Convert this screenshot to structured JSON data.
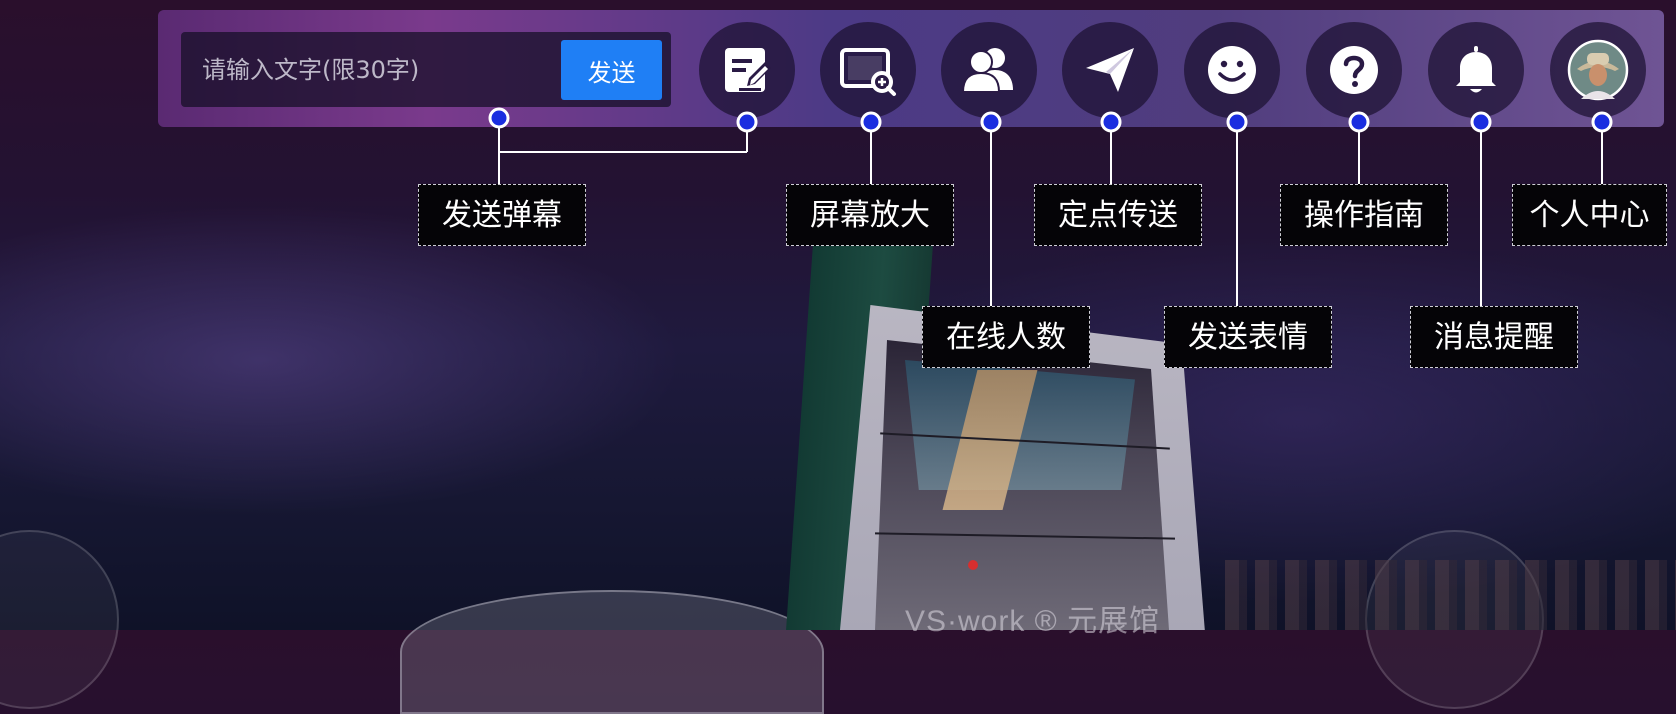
{
  "toolbar": {
    "danmaku_placeholder": "请输入文字(限30字)",
    "send_label": "发送",
    "buttons": [
      {
        "name": "danmaku",
        "icon": "edit-note-icon"
      },
      {
        "name": "zoom",
        "icon": "screen-zoom-icon"
      },
      {
        "name": "online",
        "icon": "users-icon"
      },
      {
        "name": "teleport",
        "icon": "paper-plane-icon"
      },
      {
        "name": "emoji",
        "icon": "smiley-icon"
      },
      {
        "name": "guide",
        "icon": "help-icon"
      },
      {
        "name": "notify",
        "icon": "bell-icon"
      },
      {
        "name": "profile",
        "icon": "avatar-icon"
      }
    ]
  },
  "callouts": {
    "send_danmaku": "发送弹幕",
    "zoom_screen": "屏幕放大",
    "online_count": "在线人数",
    "teleport": "定点传送",
    "send_emoji": "发送表情",
    "guide": "操作指南",
    "notify": "消息提醒",
    "profile": "个人中心"
  },
  "scene": {
    "brand_text": "VS·work ® 元展馆"
  },
  "colors": {
    "send_button": "#1f7ff5",
    "marker_dot": "#1a2de0",
    "label_bg": "#050407"
  }
}
